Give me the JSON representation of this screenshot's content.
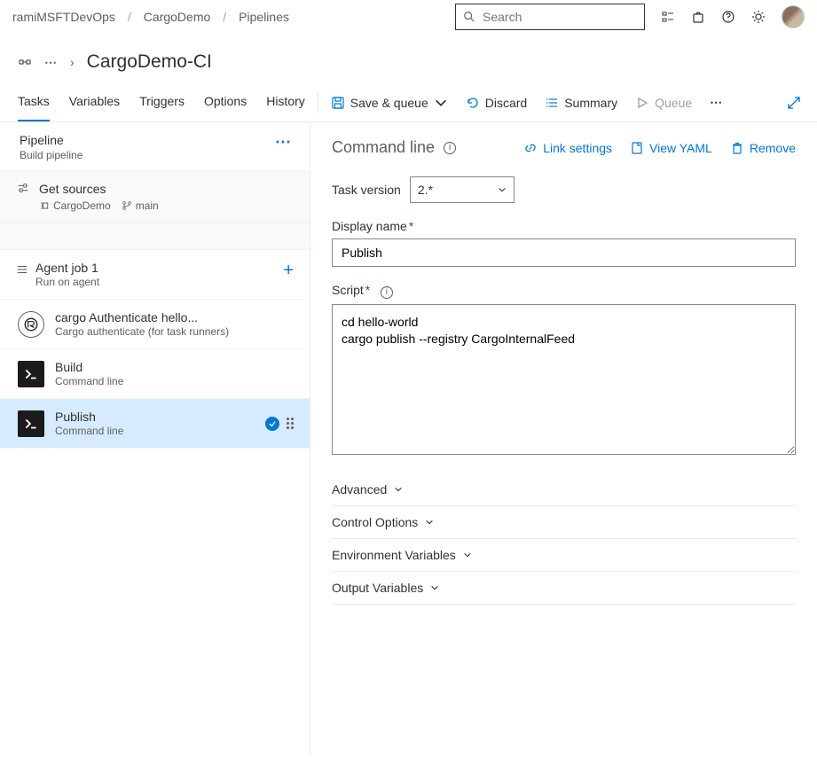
{
  "breadcrumb": {
    "org": "ramiMSFTDevOps",
    "project": "CargoDemo",
    "area": "Pipelines"
  },
  "search": {
    "placeholder": "Search"
  },
  "page": {
    "title": "CargoDemo-CI"
  },
  "tabs": {
    "tasks": "Tasks",
    "variables": "Variables",
    "triggers": "Triggers",
    "options": "Options",
    "history": "History"
  },
  "commands": {
    "save_queue": "Save & queue",
    "discard": "Discard",
    "summary": "Summary",
    "queue": "Queue"
  },
  "left": {
    "pipeline": {
      "title": "Pipeline",
      "sub": "Build pipeline"
    },
    "sources": {
      "title": "Get sources",
      "repo": "CargoDemo",
      "branch": "main"
    },
    "agent": {
      "title": "Agent job 1",
      "sub": "Run on agent"
    },
    "tasks": [
      {
        "title": "cargo Authenticate hello...",
        "sub": "Cargo authenticate (for task runners)"
      },
      {
        "title": "Build",
        "sub": "Command line"
      },
      {
        "title": "Publish",
        "sub": "Command line"
      }
    ]
  },
  "panel": {
    "title": "Command line",
    "links": {
      "link_settings": "Link settings",
      "view_yaml": "View YAML",
      "remove": "Remove"
    },
    "task_version_label": "Task version",
    "task_version_value": "2.*",
    "display_name_label": "Display name",
    "display_name_value": "Publish",
    "script_label": "Script",
    "script_value": "cd hello-world\ncargo publish --registry CargoInternalFeed",
    "sections": {
      "advanced": "Advanced",
      "control": "Control Options",
      "env": "Environment Variables",
      "output": "Output Variables"
    }
  }
}
